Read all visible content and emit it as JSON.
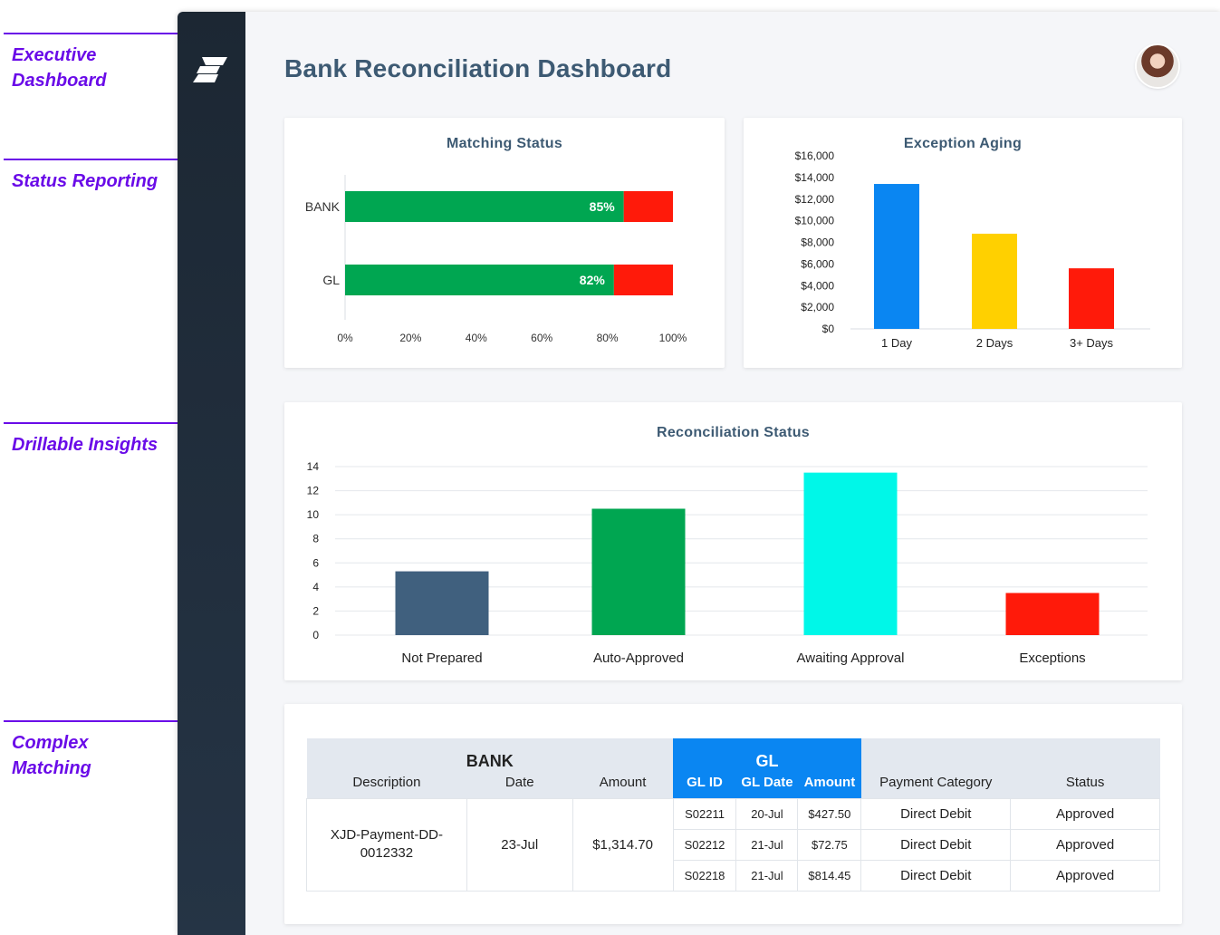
{
  "annotations": [
    {
      "label": "Executive Dashboard"
    },
    {
      "label": "Status Reporting"
    },
    {
      "label": "Drillable Insights"
    },
    {
      "label": "Complex Matching"
    }
  ],
  "header": {
    "title": "Bank Reconciliation Dashboard"
  },
  "colors": {
    "accent": "#6a0be8",
    "sidebar": "#1c2733",
    "title": "#3d5a73",
    "green": "#00a651",
    "red": "#ff1a0a",
    "blue": "#0a86f2",
    "yellow": "#ffd000",
    "cyan": "#00f7e8",
    "slate": "#40607e"
  },
  "chart_data": [
    {
      "type": "bar",
      "orientation": "horizontal-stacked",
      "title": "Matching Status",
      "categories": [
        "BANK",
        "GL"
      ],
      "series": [
        {
          "values": [
            85,
            82
          ],
          "labels": [
            "85%",
            "82%"
          ],
          "color": "#00a651"
        },
        {
          "values": [
            15,
            18
          ],
          "color": "#ff1a0a"
        }
      ],
      "xlim": [
        0,
        100
      ],
      "xticks": [
        "0%",
        "20%",
        "40%",
        "60%",
        "80%",
        "100%"
      ]
    },
    {
      "type": "bar",
      "title": "Exception Aging",
      "categories": [
        "1 Day",
        "2 Days",
        "3+ Days"
      ],
      "values": [
        13400,
        8800,
        5600
      ],
      "colors": [
        "#0a86f2",
        "#ffd000",
        "#ff1a0a"
      ],
      "ylim": [
        0,
        16000
      ],
      "yticks": [
        "$0",
        "$2,000",
        "$4,000",
        "$6,000",
        "$8,000",
        "$10,000",
        "$12,000",
        "$14,000",
        "$16,000"
      ]
    },
    {
      "type": "bar",
      "title": "Reconciliation Status",
      "categories": [
        "Not Prepared",
        "Auto-Approved",
        "Awaiting Approval",
        "Exceptions"
      ],
      "values": [
        5.3,
        10.5,
        13.5,
        3.5
      ],
      "colors": [
        "#40607e",
        "#00a651",
        "#00f7e8",
        "#ff1a0a"
      ],
      "ylim": [
        0,
        14
      ],
      "yticks": [
        "0",
        "2",
        "4",
        "6",
        "8",
        "10",
        "12",
        "14"
      ],
      "grid": true
    }
  ],
  "table": {
    "bank_group": "BANK",
    "gl_group": "GL",
    "columns": {
      "description": "Description",
      "date": "Date",
      "amount": "Amount",
      "gl_id": "GL ID",
      "gl_date": "GL Date",
      "gl_amount": "Amount",
      "payment_category": "Payment Category",
      "status": "Status"
    },
    "bank_row": {
      "description": "XJD-Payment-DD-0012332",
      "date": "23-Jul",
      "amount": "$1,314.70"
    },
    "gl_rows": [
      {
        "gl_id": "S02211",
        "gl_date": "20-Jul",
        "amount": "$427.50",
        "category": "Direct Debit",
        "status": "Approved"
      },
      {
        "gl_id": "S02212",
        "gl_date": "21-Jul",
        "amount": "$72.75",
        "category": "Direct Debit",
        "status": "Approved"
      },
      {
        "gl_id": "S02218",
        "gl_date": "21-Jul",
        "amount": "$814.45",
        "category": "Direct Debit",
        "status": "Approved"
      }
    ]
  }
}
